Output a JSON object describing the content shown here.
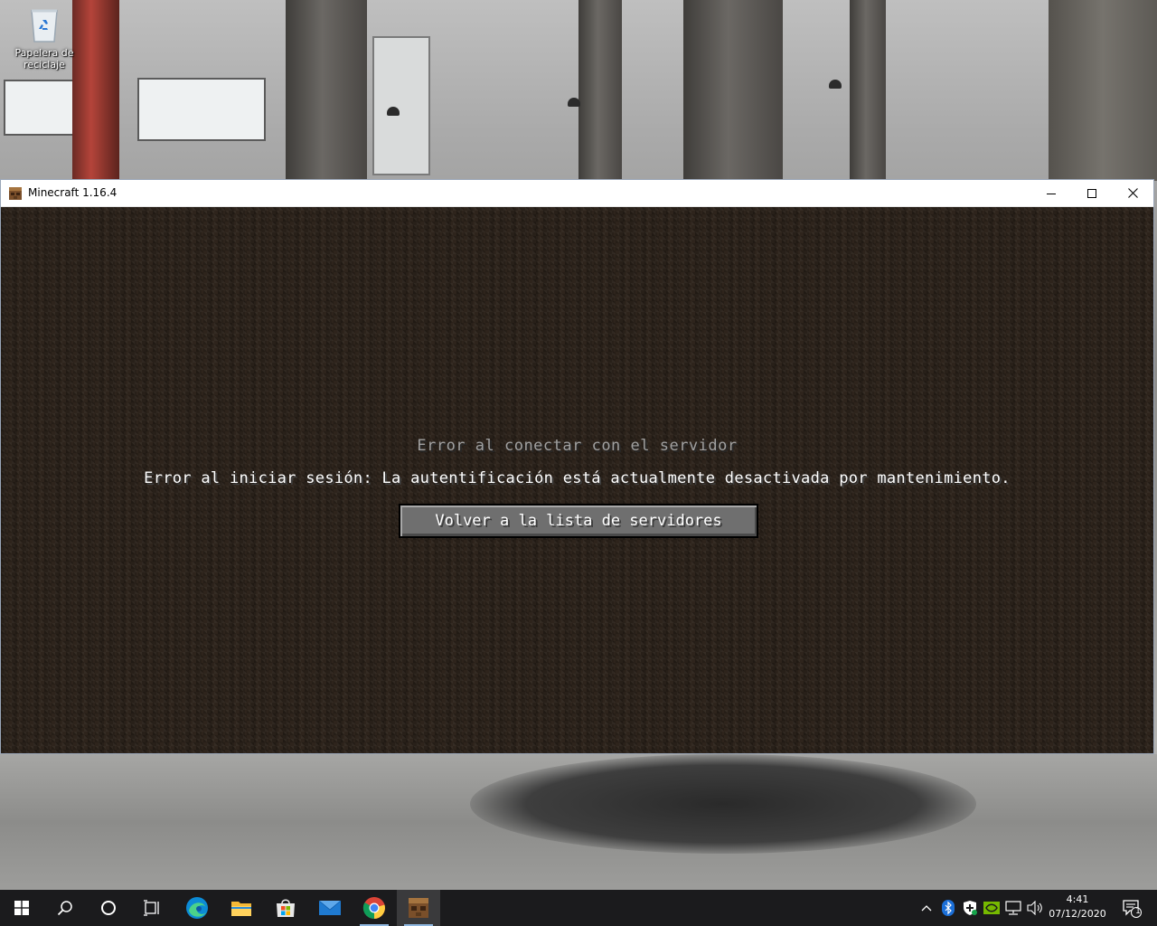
{
  "desktop": {
    "recycle_bin_label": "Papelera de reciclaje"
  },
  "window": {
    "title": "Minecraft 1.16.4",
    "minimize_icon": "minimize-icon",
    "maximize_icon": "maximize-icon",
    "close_icon": "close-icon"
  },
  "game": {
    "heading": "Error al conectar con el servidor",
    "message": "Error al iniciar sesión: La autentificación está actualmente desactivada por mantenimiento.",
    "back_button_label": "Volver a la lista de servidores"
  },
  "taskbar": {
    "pinned": [
      "start-icon",
      "search-icon",
      "cortana-icon",
      "task-view-icon",
      "edge-icon",
      "file-explorer-icon",
      "store-icon",
      "mail-icon",
      "chrome-icon",
      "minecraft-icon"
    ],
    "tray_icons": [
      "chevron-up-icon",
      "bluetooth-icon",
      "security-icon",
      "nvidia-icon",
      "network-icon",
      "volume-icon"
    ],
    "time": "4:41",
    "date": "07/12/2020",
    "notification_count": "1"
  }
}
